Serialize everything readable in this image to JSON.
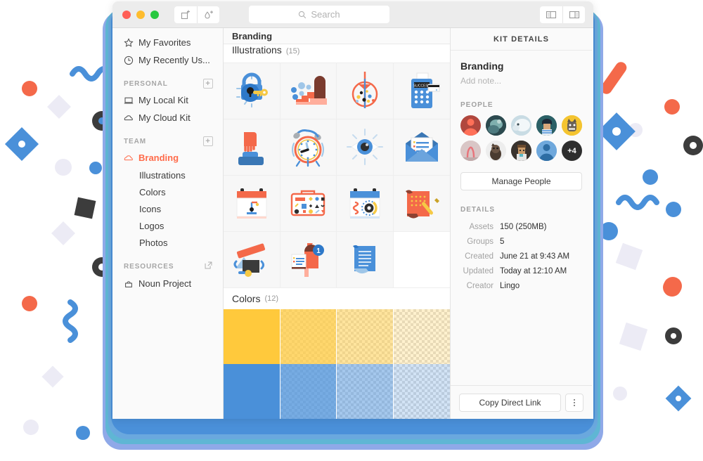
{
  "window": {
    "traffic_lights": [
      "close",
      "minimize",
      "maximize"
    ],
    "toolbar": {
      "add_asset_label": "add-asset",
      "add_color_label": "add-color",
      "toggle_left_panel_label": "toggle-left-panel",
      "toggle_right_panel_label": "toggle-right-panel"
    },
    "search": {
      "placeholder": "Search",
      "value": ""
    }
  },
  "sidebar": {
    "quick": [
      {
        "label": "My Favorites",
        "icon": "star-icon"
      },
      {
        "label": "My Recently Us...",
        "icon": "clock-icon"
      }
    ],
    "personal": {
      "header": "PERSONAL",
      "add_label": "+",
      "items": [
        {
          "label": "My Local Kit",
          "icon": "laptop-icon"
        },
        {
          "label": "My Cloud Kit",
          "icon": "cloud-icon"
        }
      ]
    },
    "team": {
      "header": "TEAM",
      "add_label": "+",
      "items": [
        {
          "label": "Branding",
          "icon": "cloud-icon",
          "active": true
        },
        {
          "label": "Illustrations",
          "active": false
        },
        {
          "label": "Colors",
          "active": false
        },
        {
          "label": "Icons",
          "active": false
        },
        {
          "label": "Logos",
          "active": false
        },
        {
          "label": "Photos",
          "active": false
        }
      ]
    },
    "resources": {
      "header": "RESOURCES",
      "external_label": "external-link",
      "items": [
        {
          "label": "Noun Project",
          "icon": "bag-icon"
        }
      ]
    }
  },
  "center": {
    "title": "Branding",
    "sections": [
      {
        "name": "Illustrations",
        "count": "(15)",
        "type": "assets"
      },
      {
        "name": "Colors",
        "count": "(12)",
        "type": "colors"
      }
    ],
    "illustrations": [
      "padlock-key",
      "stairs-door",
      "target-confetti",
      "card-terminal",
      "hand-button",
      "alarm-clock",
      "eye-shine",
      "open-envelope",
      "calendar-crane",
      "toolbox",
      "calendar-gears",
      "red-scroll-pen",
      "broken-frame",
      "mailbox-notification",
      "blue-document"
    ],
    "color_swatches": [
      {
        "hex": "#FFC93C",
        "alpha": 1.0
      },
      {
        "hex": "#FFC93C",
        "alpha": 0.75
      },
      {
        "hex": "#FFC93C",
        "alpha": 0.5
      },
      {
        "hex": "#FFC93C",
        "alpha": 0.25
      },
      {
        "hex": "#4A90D9",
        "alpha": 1.0
      },
      {
        "hex": "#4A90D9",
        "alpha": 0.75
      },
      {
        "hex": "#4A90D9",
        "alpha": 0.5
      },
      {
        "hex": "#4A90D9",
        "alpha": 0.25
      }
    ]
  },
  "kit_details": {
    "header": "KIT DETAILS",
    "title": "Branding",
    "note_placeholder": "Add note...",
    "people_label": "PEOPLE",
    "people": [
      {
        "name": "avatar-person-coral",
        "type": "icon",
        "bg": "#B0473E",
        "fg": "#FF7058"
      },
      {
        "name": "avatar-photo-teal",
        "type": "photo",
        "bg": "#2C4A4F",
        "fg": "#7FAFAE"
      },
      {
        "name": "avatar-photo-white-animal",
        "type": "photo",
        "bg": "#C9DCE4",
        "fg": "#FFFFFF"
      },
      {
        "name": "avatar-illustration-person",
        "type": "photo",
        "bg": "#2B6066",
        "fg": "#1E2A38"
      },
      {
        "name": "avatar-cat-yellow",
        "type": "photo",
        "bg": "#F4C430",
        "fg": "#4A4A4A"
      },
      {
        "name": "avatar-photo-flamingo",
        "type": "photo",
        "bg": "#D9C6C6",
        "fg": "#E8737A"
      },
      {
        "name": "avatar-photo-dog",
        "type": "photo",
        "bg": "#EDEDED",
        "fg": "#4A3B30"
      },
      {
        "name": "avatar-pixel-character",
        "type": "photo",
        "bg": "#3A332E",
        "fg": "#C99B6B"
      },
      {
        "name": "avatar-person-blue",
        "type": "icon",
        "bg": "#6FA8DC",
        "fg": "#2E6DA4"
      },
      {
        "name": "avatar-more-count",
        "type": "count",
        "label": "+4"
      }
    ],
    "manage_people_label": "Manage People",
    "details_label": "DETAILS",
    "details": [
      {
        "key": "Assets",
        "value": "150 (250MB)"
      },
      {
        "key": "Groups",
        "value": "5"
      },
      {
        "key": "Created",
        "value": "June 21 at 9:43 AM"
      },
      {
        "key": "Updated",
        "value": "Today at 12:10 AM"
      },
      {
        "key": "Creator",
        "value": "Lingo"
      }
    ],
    "copy_link_label": "Copy Direct Link",
    "more_label": "more-options"
  },
  "theme": {
    "accent": "#FF6B4A",
    "blue": "#4A90D9",
    "yellow": "#FFC93C",
    "window_bg": "#FAFAFA"
  }
}
